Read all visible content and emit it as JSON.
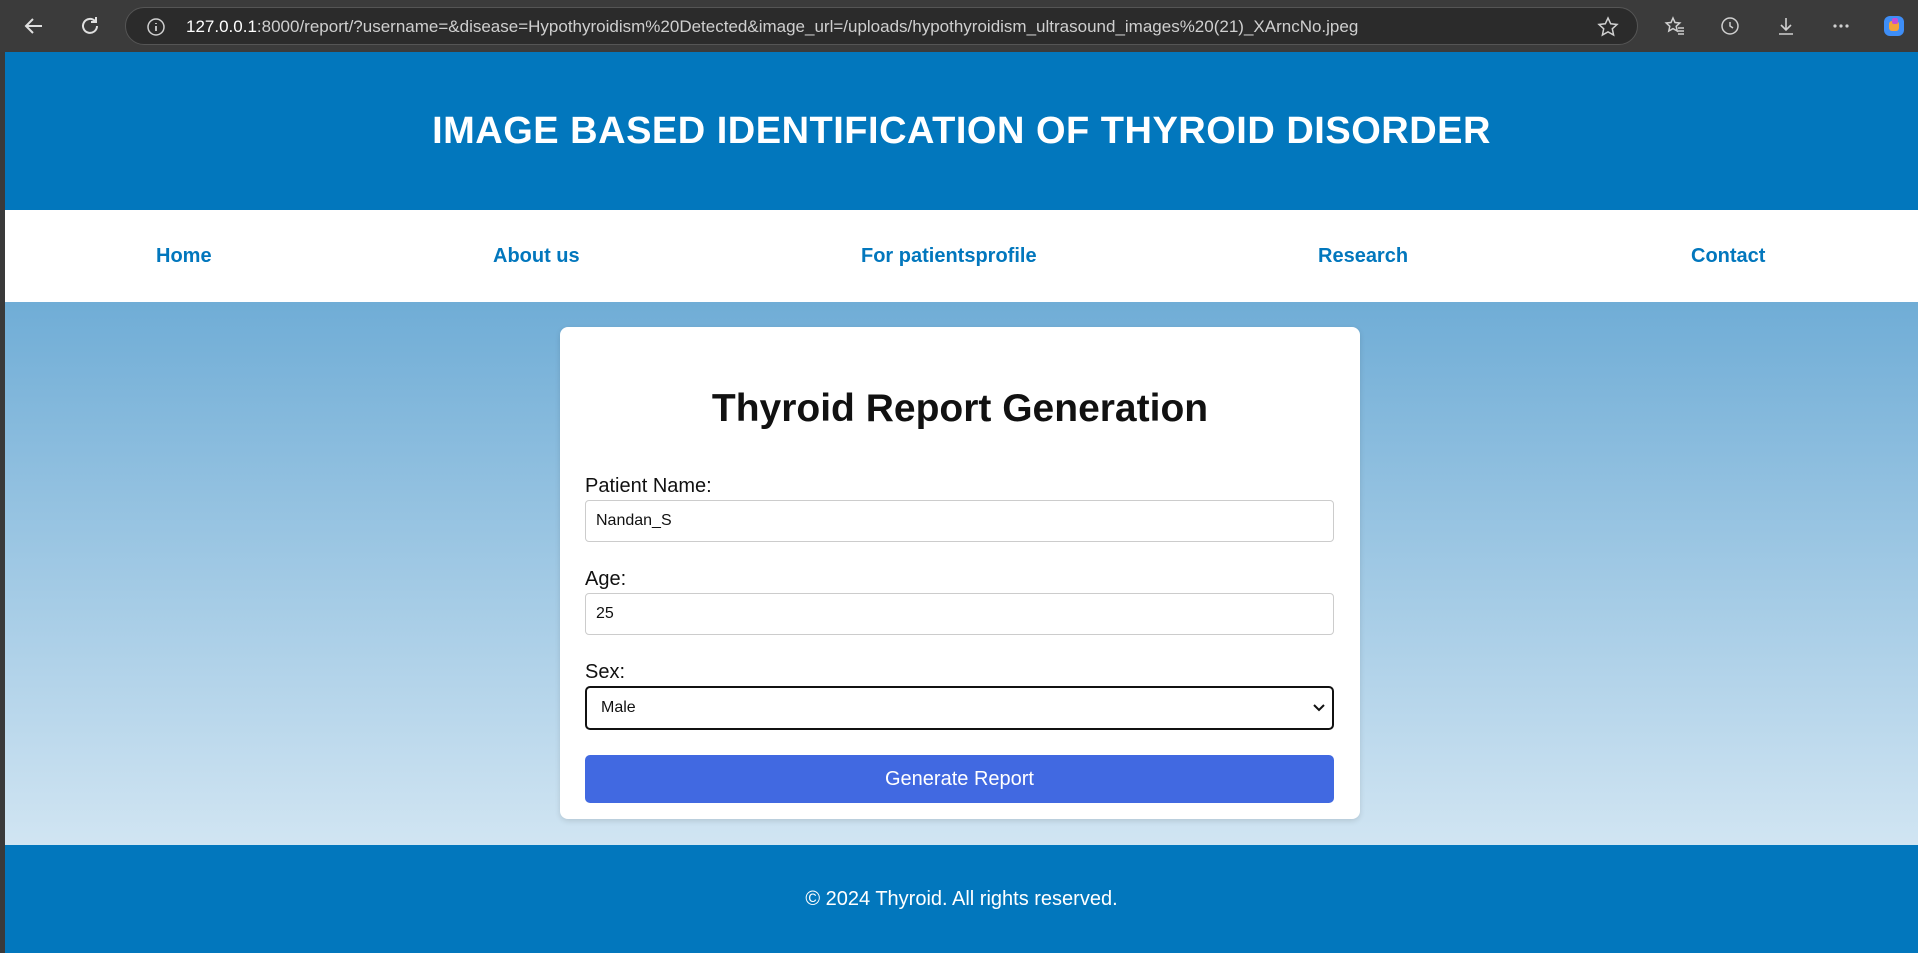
{
  "browser": {
    "url_host": "127.0.0.1",
    "url_rest": ":8000/report/?username=&disease=Hypothyroidism%20Detected&image_url=/uploads/hypothyroidism_ultrasound_images%20(21)_XArncNo.jpeg",
    "icons": [
      "back-icon",
      "reload-icon",
      "info-icon",
      "star-icon",
      "favorites-icon",
      "history-icon",
      "download-icon",
      "more-icon",
      "copilot-icon"
    ]
  },
  "header": {
    "title": "IMAGE BASED IDENTIFICATION OF THYROID DISORDER"
  },
  "nav": {
    "items": [
      {
        "label": "Home"
      },
      {
        "label": "About us"
      },
      {
        "label": "For patientsprofile"
      },
      {
        "label": "Research"
      },
      {
        "label": "Contact"
      }
    ]
  },
  "form": {
    "title": "Thyroid Report Generation",
    "name_label": "Patient Name:",
    "name_value": "Nandan_S",
    "age_label": "Age:",
    "age_value": "25",
    "sex_label": "Sex:",
    "sex_value": "Male",
    "submit_label": "Generate Report"
  },
  "footer": {
    "text": "© 2024 Thyroid. All rights reserved."
  },
  "colors": {
    "primary": "#0277bd",
    "button": "#4169e1",
    "gradient_top": "#4393c9",
    "gradient_bottom": "#e4f0f8"
  }
}
